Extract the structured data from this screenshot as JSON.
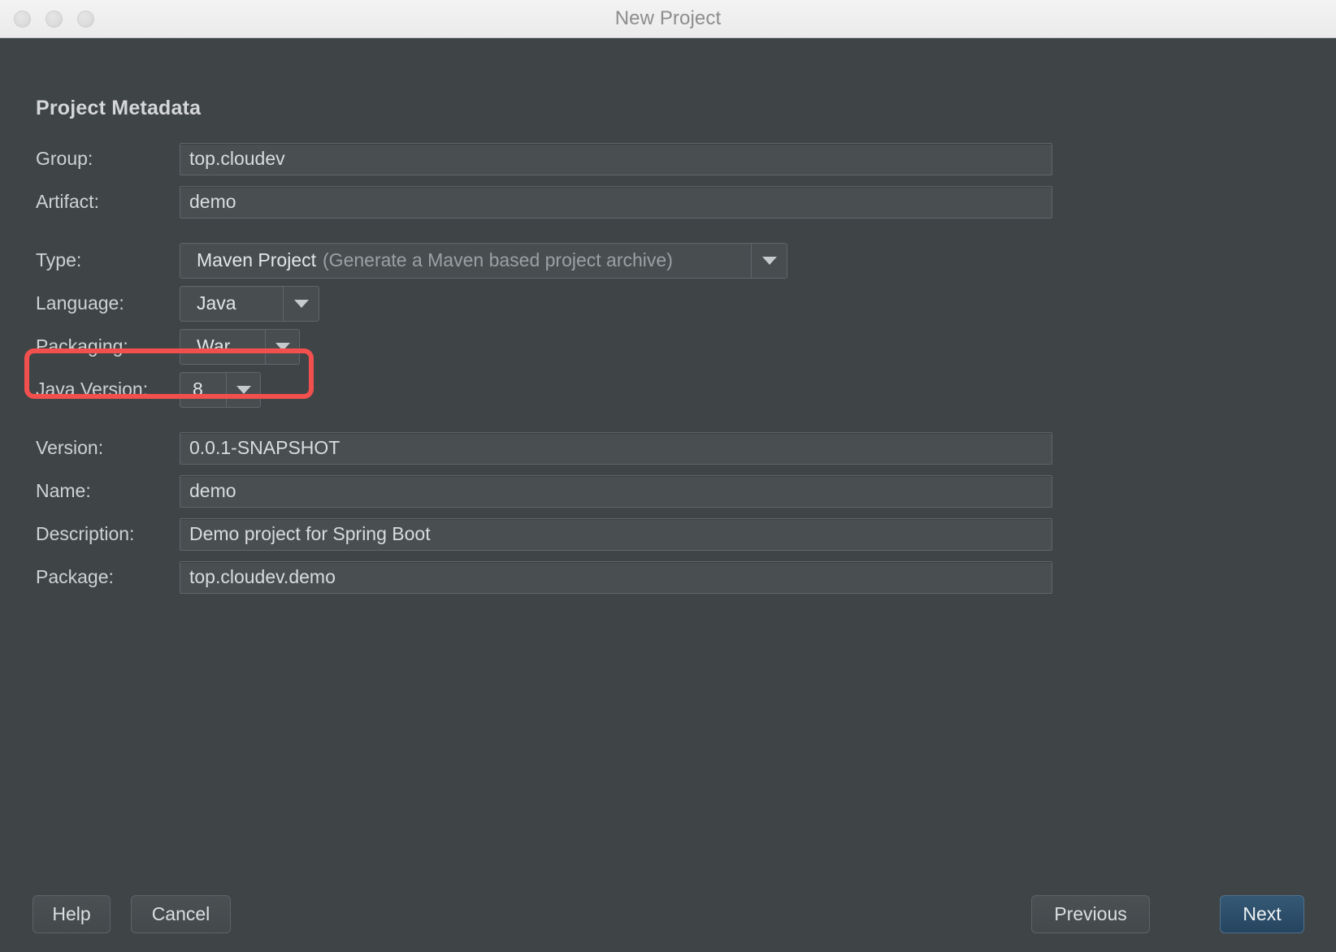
{
  "window": {
    "title": "New Project",
    "traffic_lights": [
      "close",
      "minimize",
      "zoom"
    ]
  },
  "heading": "Project Metadata",
  "form": {
    "group": {
      "label": "Group:",
      "value": "top.cloudev"
    },
    "artifact": {
      "label": "Artifact:",
      "value": "demo"
    },
    "type": {
      "label": "Type:",
      "value": "Maven Project",
      "value_hint": "(Generate a Maven based project archive)"
    },
    "language": {
      "label": "Language:",
      "value": "Java"
    },
    "packaging": {
      "label": "Packaging:",
      "value": "War"
    },
    "java_version": {
      "label": "Java Version:",
      "value": "8"
    },
    "version": {
      "label": "Version:",
      "value": "0.0.1-SNAPSHOT"
    },
    "name": {
      "label": "Name:",
      "value": "demo"
    },
    "description": {
      "label": "Description:",
      "value": "Demo project for Spring Boot"
    },
    "package": {
      "label": "Package:",
      "value": "top.cloudev.demo"
    }
  },
  "annotation": {
    "target": "packaging-row",
    "color": "#f2504e"
  },
  "footer": {
    "help": "Help",
    "cancel": "Cancel",
    "previous": "Previous",
    "next": "Next"
  },
  "colors": {
    "dialog_background": "#3f4447",
    "field_background": "#494e51",
    "field_border": "#5f6568",
    "text": "#d9dcdd",
    "muted_text": "#9aa0a3",
    "titlebar": "#f0f0f0",
    "title_text": "#8d8d8d",
    "accent_button": "#355975",
    "highlight": "#f2504e"
  }
}
